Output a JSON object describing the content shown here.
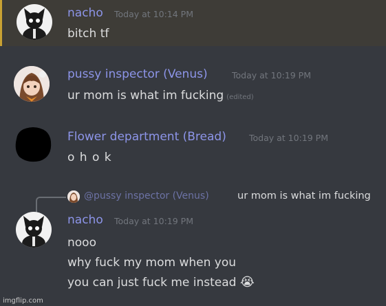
{
  "colors": {
    "background": "#36393f",
    "highlight_background": "#3e3c37",
    "highlight_bar": "#c9a233",
    "username": "#8d95e9",
    "timestamp": "#72767d",
    "message_text": "#dcddde",
    "reply_line": "#6a6e74"
  },
  "messages": [
    {
      "username": "nacho",
      "timestamp": "Today at 10:14 PM",
      "lines": [
        "bitch tf"
      ],
      "avatar_icon": "black-cat-avatar"
    },
    {
      "username": "pussy inspector (Venus)",
      "timestamp": "Today at 10:19 PM",
      "lines": [
        "ur mom is what im fucking"
      ],
      "edited_label": "(edited)",
      "avatar_icon": "anime-girl-avatar"
    },
    {
      "username": "Flower department (Bread)",
      "timestamp": "Today at 10:19 PM",
      "lines": [
        "o h o k"
      ],
      "avatar_icon": "blacked-out-avatar"
    },
    {
      "reply": {
        "username": "@pussy inspector (Venus)",
        "text": "ur mom is what im fucking",
        "avatar_icon": "anime-girl-mini-avatar"
      },
      "username": "nacho",
      "timestamp": "Today at 10:19 PM",
      "lines": [
        "nooo",
        "why fuck my mom when you",
        "you can just fuck me instead"
      ],
      "emoji": "😭",
      "avatar_icon": "black-cat-avatar"
    }
  ],
  "watermark": "imgflip.com"
}
